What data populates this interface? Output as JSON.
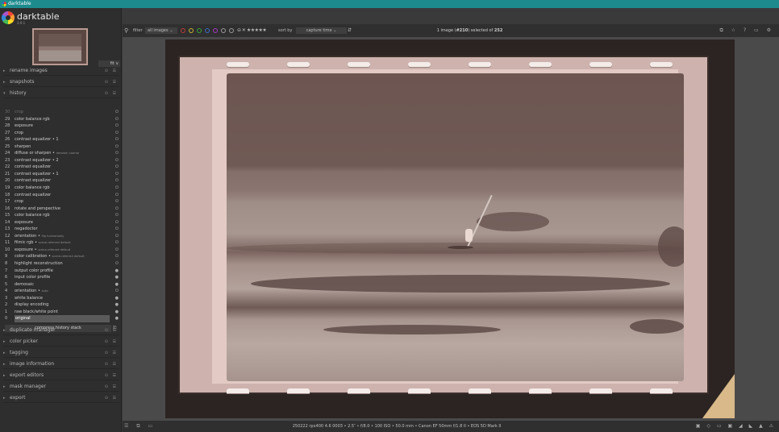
{
  "window": {
    "title": "darktable"
  },
  "app": {
    "brand": "darktable",
    "version": "3.9.1"
  },
  "thumbnail": {
    "control": "fit ∨"
  },
  "sections_top": [
    {
      "label": "rename images",
      "arrow": "▸"
    },
    {
      "label": "snapshots",
      "arrow": "▸"
    },
    {
      "label": "history",
      "arrow": "▾"
    }
  ],
  "history": [
    {
      "num": "30",
      "label": "crop",
      "mod": "",
      "state": "dim"
    },
    {
      "num": "29",
      "label": "color balance rgb",
      "mod": ""
    },
    {
      "num": "28",
      "label": "exposure",
      "mod": ""
    },
    {
      "num": "27",
      "label": "crop",
      "mod": ""
    },
    {
      "num": "26",
      "label": "contrast equalizer • 1",
      "mod": ""
    },
    {
      "num": "25",
      "label": "sharpen",
      "mod": ""
    },
    {
      "num": "24",
      "label": "diffuse or sharpen • ",
      "mod": "denoise: coarse"
    },
    {
      "num": "23",
      "label": "contrast equalizer • 2",
      "mod": ""
    },
    {
      "num": "22",
      "label": "contrast equalizer",
      "mod": ""
    },
    {
      "num": "21",
      "label": "contrast equalizer • 1",
      "mod": ""
    },
    {
      "num": "20",
      "label": "contrast equalizer",
      "mod": ""
    },
    {
      "num": "19",
      "label": "color balance rgb",
      "mod": ""
    },
    {
      "num": "18",
      "label": "contrast equalizer",
      "mod": ""
    },
    {
      "num": "17",
      "label": "crop",
      "mod": ""
    },
    {
      "num": "16",
      "label": "rotate and perspective",
      "mod": ""
    },
    {
      "num": "15",
      "label": "color balance rgb",
      "mod": ""
    },
    {
      "num": "14",
      "label": "exposure",
      "mod": ""
    },
    {
      "num": "13",
      "label": "negadoctor",
      "mod": ""
    },
    {
      "num": "12",
      "label": "orientation • ",
      "mod": "flip horizontally"
    },
    {
      "num": "11",
      "label": "filmic rgb • ",
      "mod": "scene-referred default"
    },
    {
      "num": "10",
      "label": "exposure • ",
      "mod": "scene-referred default"
    },
    {
      "num": "9",
      "label": "color calibration • ",
      "mod": "scene-referred default"
    },
    {
      "num": "8",
      "label": "highlight reconstruction",
      "mod": ""
    },
    {
      "num": "7",
      "label": "output color profile",
      "mod": ""
    },
    {
      "num": "6",
      "label": "input color profile",
      "mod": ""
    },
    {
      "num": "5",
      "label": "demosaic",
      "mod": ""
    },
    {
      "num": "4",
      "label": "orientation • ",
      "mod": "auto"
    },
    {
      "num": "3",
      "label": "white balance",
      "mod": ""
    },
    {
      "num": "2",
      "label": "display encoding",
      "mod": ""
    },
    {
      "num": "1",
      "label": "raw black/white point",
      "mod": ""
    },
    {
      "num": "0",
      "label": "original",
      "mod": "",
      "state": "sel"
    }
  ],
  "compress_label": "compress history stack",
  "sections_bottom": [
    {
      "label": "duplicate manager",
      "arrow": "▸"
    },
    {
      "label": "color picker",
      "arrow": "▸"
    },
    {
      "label": "tagging",
      "arrow": "▸"
    },
    {
      "label": "image information",
      "arrow": "▸"
    },
    {
      "label": "export editors",
      "arrow": "▸"
    },
    {
      "label": "mask manager",
      "arrow": "▸"
    },
    {
      "label": "export",
      "arrow": "▸"
    }
  ],
  "topbar": {
    "filter_label": "filter",
    "filter_value": "all images ⌄",
    "rating": "⊖ ✕ ★★★★★",
    "sort_label": "sort by",
    "sort_value": "capture time ⌄",
    "count_pre": "1 image (",
    "count_id": "#210",
    "count_mid": ") selected of ",
    "count_total": "252",
    "right_icons": "⧉ ☆ ? ▭ ⚙"
  },
  "color_labels": [
    "#c03a3a",
    "#c8b238",
    "#3aa33a",
    "#3a6ec8",
    "#a43ac0",
    "#9a9a9a",
    "#9a9a9a"
  ],
  "bottombar": {
    "info": "250222 rpx400 4.6 0003 • 2.5″ • f/8.0 • 100 ISO • 50.0 mm • Canon EF 50mm f/1.8 II • EOS 5D Mark II",
    "left_icons": "☰ ⧉ ▭",
    "right_icons": "▣ ◇ ▭ ▣ ◢ ◣ ▲ ⚠"
  }
}
